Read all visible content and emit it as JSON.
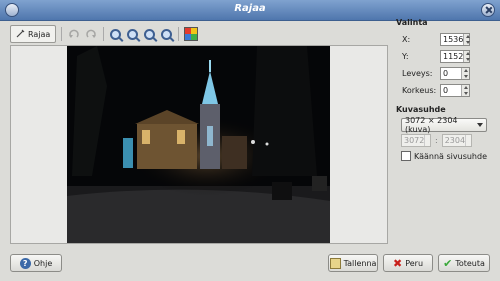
{
  "window": {
    "title": "Rajaa"
  },
  "toolbar": {
    "crop_tool": "Rajaa",
    "icons": [
      "crop-icon",
      "rotate-left-icon",
      "rotate-right-icon",
      "zoom-in-icon",
      "zoom-out-icon",
      "zoom-fit-icon",
      "zoom-original-icon",
      "color-icon"
    ]
  },
  "selection": {
    "title": "Valinta",
    "x_label": "X:",
    "x_value": "1536",
    "y_label": "Y:",
    "y_value": "1152",
    "width_label": "Leveys:",
    "width_value": "0",
    "height_label": "Korkeus:",
    "height_value": "0"
  },
  "aspect": {
    "title": "Kuvasuhde",
    "selected": "3072 × 2304 (kuva)",
    "ratio_w": "3072",
    "ratio_h": "2304",
    "swap_label": "Käännä sivusuhde"
  },
  "buttons": {
    "help": "Ohje",
    "save": "Tallenna",
    "cancel": "Peru",
    "apply": "Toteuta"
  },
  "colors": {
    "title_bar": "#5a80b6",
    "photo_bg": "#0a0a0a",
    "accent": "#3b69a8"
  }
}
